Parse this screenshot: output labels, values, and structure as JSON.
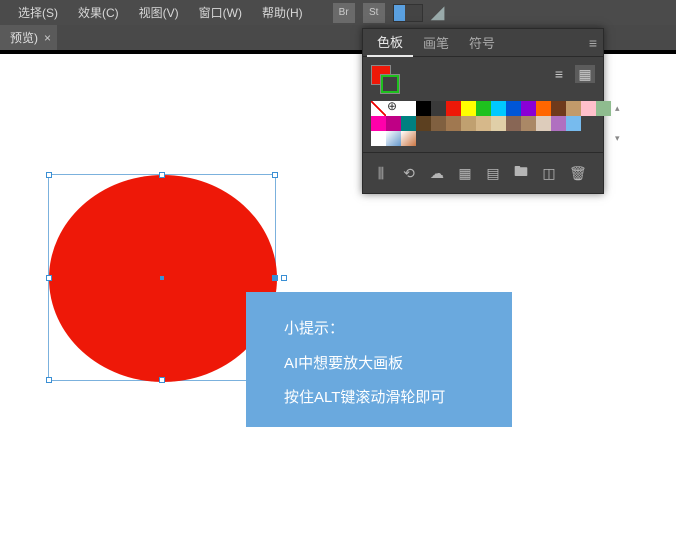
{
  "menubar": {
    "items": [
      "选择(S)",
      "效果(C)",
      "视图(V)",
      "窗口(W)",
      "帮助(H)"
    ],
    "br_label": "Br",
    "st_label": "St"
  },
  "tab": {
    "title": "预览)",
    "close": "×"
  },
  "panel": {
    "tabs": [
      "色板",
      "画笔",
      "符号"
    ],
    "active_tab": 0,
    "menu_icon": "≡",
    "collapse": "◂◂",
    "close": "×",
    "view_list_icon": "≡",
    "view_grid_icon": "▦",
    "scroll_up": "▴",
    "scroll_down": "▾",
    "bottom_icons": {
      "library": "⫼",
      "show_kinds": "⟲",
      "color_group": "☁",
      "options": "▦",
      "new_group": "▤",
      "new_swatch": "🖿",
      "edit": "◫",
      "delete": "🗑"
    }
  },
  "colors": {
    "fill": "#ee1808",
    "stroke": "#1ec11e",
    "row1": [
      "#ffffff",
      "#000000",
      "#3a3a3a",
      "#ee1808",
      "#ffff00",
      "#1ec11e",
      "#00c9ff",
      "#0056d6",
      "#8a00d6",
      "#ff6600",
      "#6f3a1c",
      "#c29a6a",
      "#ffc0cb",
      "#8fbc8f"
    ],
    "row2": [
      "#ff00aa",
      "#bf0085",
      "#008080",
      "#5c4020",
      "#806040",
      "#a07850",
      "#c0a070",
      "#d6b88a",
      "#e0cfa8",
      "#886655",
      "#aa8866",
      "#ddccbb",
      "#b070c0",
      "#77bbee"
    ],
    "gradient": [
      "#ffffff",
      "#6699cc",
      "#cc7744"
    ]
  },
  "tip": {
    "line1": "小提示：",
    "line2": "AI中想要放大画板",
    "line3": "按住ALT键滚动滑轮即可"
  }
}
